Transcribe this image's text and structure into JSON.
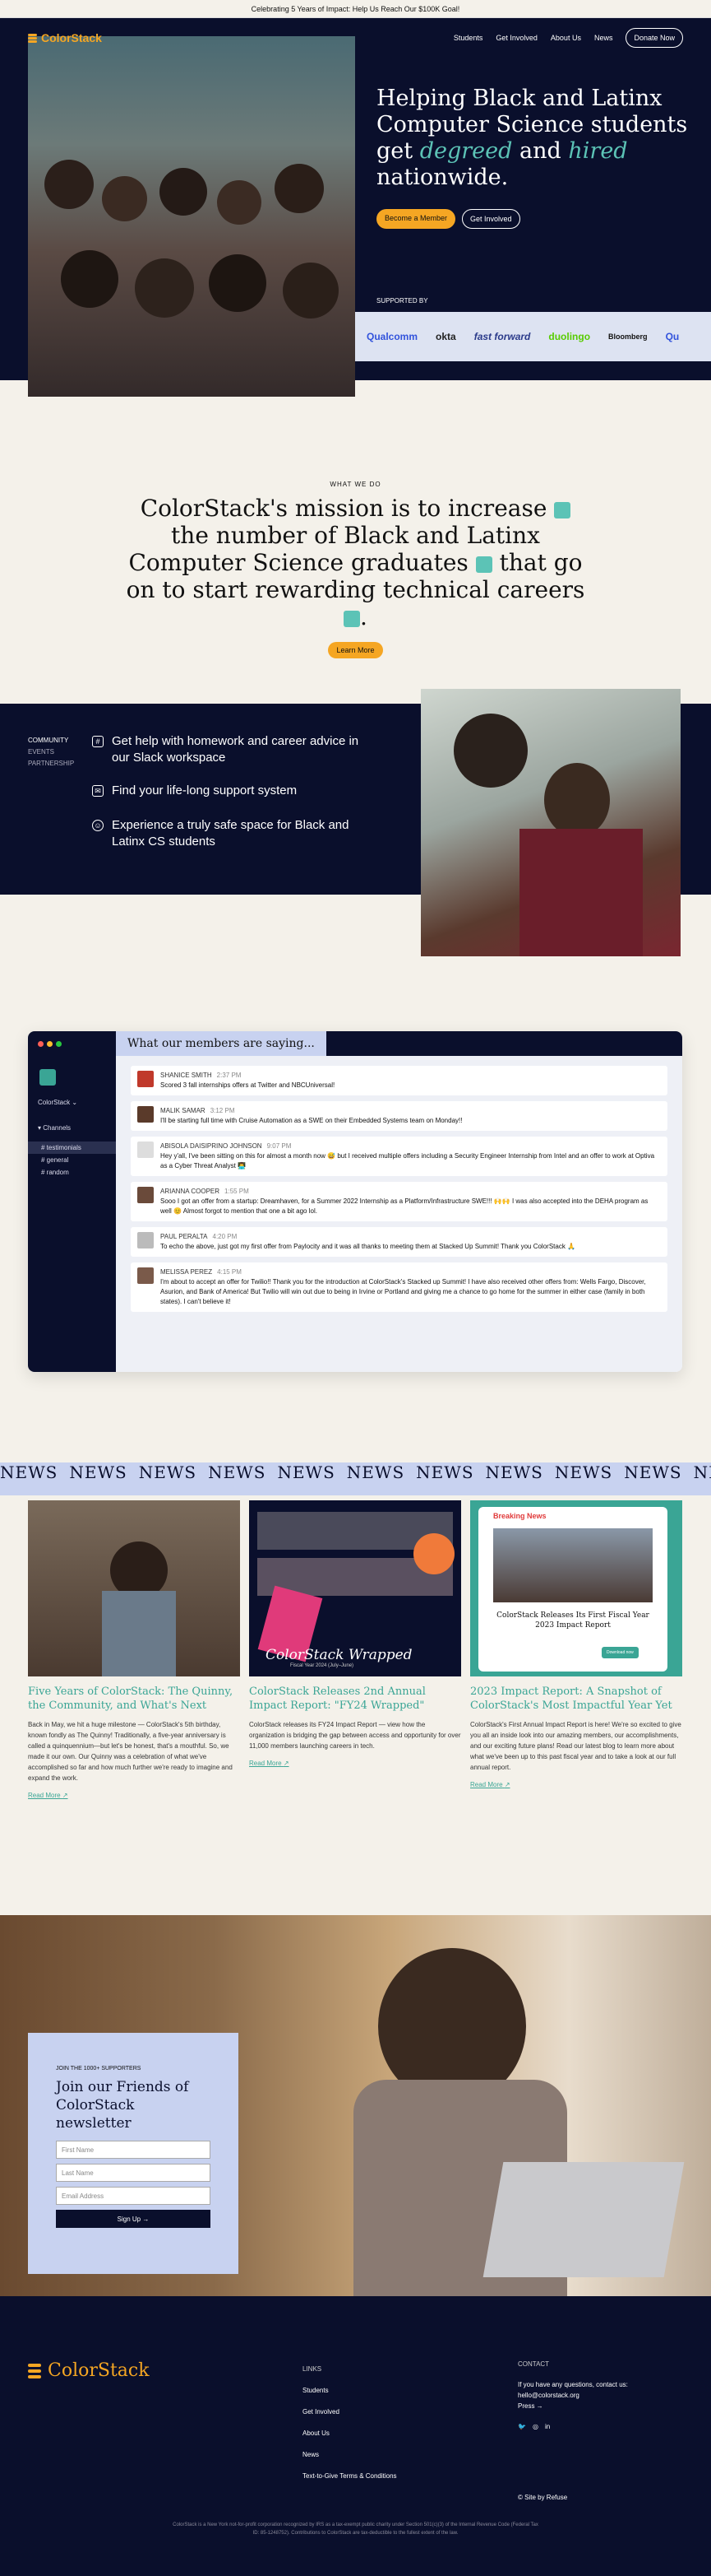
{
  "banner": {
    "text": "Celebrating 5 Years of Impact: Help Us Reach Our $100K Goal!"
  },
  "nav": {
    "brand": "ColorStack",
    "links": [
      "Students",
      "Get Involved",
      "About Us",
      "News"
    ],
    "donate": "Donate Now"
  },
  "hero": {
    "title_line1": "Helping Black and Latinx",
    "title_line2": "Computer Science students",
    "title_get": "get",
    "title_degreed": "degreed",
    "title_and": "and",
    "title_hired": "hired",
    "title_line4": "nationwide.",
    "btn_member": "Become a Member",
    "btn_involved": "Get Involved",
    "supported_label": "SUPPORTED BY",
    "sponsors": [
      {
        "name": "Qualcomm",
        "color": "#3253dc"
      },
      {
        "name": "okta",
        "color": "#222222"
      },
      {
        "name": "fast forward",
        "color": "#2a3a8a"
      },
      {
        "name": "duolingo",
        "color": "#58cc02"
      },
      {
        "name": "Bloomberg",
        "color": "#111111"
      },
      {
        "name": "Qu",
        "color": "#3253dc"
      }
    ]
  },
  "mission": {
    "eyebrow": "WHAT WE DO",
    "text_a": "ColorStack's mission is to increase",
    "text_b": "the number of Black and Latinx Computer Science graduates",
    "text_c": "that go on to start rewarding technical careers",
    "text_d": ".",
    "btn": "Learn More"
  },
  "community": {
    "menu": [
      "COMMUNITY",
      "EVENTS",
      "PARTNERSHIP"
    ],
    "items": [
      {
        "icon": "slack-icon",
        "text": "Get help with homework and career advice in our Slack workspace"
      },
      {
        "icon": "mail-icon",
        "text": "Find your life-long support system"
      },
      {
        "icon": "smile-icon",
        "text": "Experience a truly safe space for Black and Latinx CS students"
      }
    ]
  },
  "slack": {
    "tab_title": "What our members are saying...",
    "workspace": "ColorStack",
    "channels_label": "Channels",
    "channels": [
      "# testimonials",
      "# general",
      "# random"
    ],
    "messages": [
      {
        "name": "SHANICE SMITH",
        "time": "2:37 PM",
        "text": "Scored 3 fall internships offers at Twitter and NBCUniversal!"
      },
      {
        "name": "MALIK SAMAR",
        "time": "3:12 PM",
        "text": "I'll be starting full time with Cruise Automation as a SWE on their Embedded Systems team on Monday!!"
      },
      {
        "name": "ABISOLA DAISIPRINO JOHNSON",
        "time": "9:07 PM",
        "text": "Hey y'all, I've been sitting on this for almost a month now 😅 but I received multiple offers including a Security Engineer Internship from Intel and an offer to work at Optiva as a Cyber Threat Analyst 👨‍💻"
      },
      {
        "name": "ARIANNA COOPER",
        "time": "1:55 PM",
        "text": "Sooo I got an offer from a startup: Dreamhaven, for a Summer 2022 Internship as a Platform/Infrastructure SWE!!! 🙌🙌 I was also accepted into the DEHA program as well 😊 Almost forgot to mention that one a bit ago lol."
      },
      {
        "name": "PAUL PERALTA",
        "time": "4:20 PM",
        "text": "To echo the above, just got my first offer from Paylocity and it was all thanks to meeting them at Stacked Up Summit! Thank you ColorStack 🙏"
      },
      {
        "name": "MELISSA PEREZ",
        "time": "4:15 PM",
        "text": "I'm about to accept an offer for Twilio!! Thank you for the introduction at ColorStack's Stacked up Summit! I have also received other offers from: Wells Fargo, Discover, Asurion, and Bank of America! But Twilio will win out due to being in Irvine or Portland and giving me a chance to go home for the summer in either case (family in both states). I can't believe it!"
      }
    ]
  },
  "news": {
    "band_word": "NEWS",
    "cards": [
      {
        "title": "Five Years of ColorStack: The Quinny, the Community, and What's Next",
        "body": "Back in May, we hit a huge milestone — ColorStack's 5th birthday, known fondly as The Quinny! Traditionally, a five-year anniversary is called a quinquennium—but let's be honest, that's a mouthful. So, we made it our own. Our Quinny was a celebration of what we've accomplished so far and how much further we're ready to imagine and expand the work.",
        "link": "Read More"
      },
      {
        "title": "ColorStack Releases 2nd Annual Impact Report: \"FY24 Wrapped\"",
        "body": "ColorStack releases its FY24 Impact Report — view how the organization is bridging the gap between access and opportunity for over 11,000 members launching careers in tech.",
        "link": "Read More",
        "overlay_title": "ColorStack Wrapped",
        "overlay_sub": "Fiscal Year 2024 (July–June)"
      },
      {
        "title": "2023 Impact Report: A Snapshot of ColorStack's Most Impactful Year Yet",
        "body": "ColorStack's First Annual Impact Report is here! We're so excited to give you all an inside look into our amazing members, our accomplishments, and our exciting future plans! Read our latest blog to learn more about what we've been up to this past fiscal year and to take a look at our full annual report.",
        "link": "Read More",
        "overlay_tag": "Breaking News",
        "overlay_title": "ColorStack Releases Its First Fiscal Year 2023 Impact Report",
        "overlay_btn": "Download now"
      }
    ]
  },
  "newsletter": {
    "eyebrow": "JOIN THE 1000+ SUPPORTERS",
    "title": "Join our Friends of ColorStack newsletter",
    "first": "First Name",
    "last": "Last Name",
    "email": "Email Address",
    "btn": "Sign Up →"
  },
  "footer": {
    "brand": "ColorStack",
    "links_head": "LINKS",
    "links": [
      "Students",
      "Get Involved",
      "About Us",
      "News",
      "Text-to-Give Terms & Conditions"
    ],
    "contact_head": "CONTACT",
    "contact_line1": "If you have any questions, contact us:",
    "contact_email": "hello@colorstack.org",
    "press": "Press →",
    "credit": "© Site by Refuse",
    "legal1": "ColorStack is a New York not-for-profit corporation recognized by IRS as a tax-exempt public charity under Section 501(c)(3) of the Internal Revenue Code (Federal Tax",
    "legal2": "ID: 85-1248752). Contributions to ColorStack are tax-deductible to the fullest extent of the law."
  }
}
